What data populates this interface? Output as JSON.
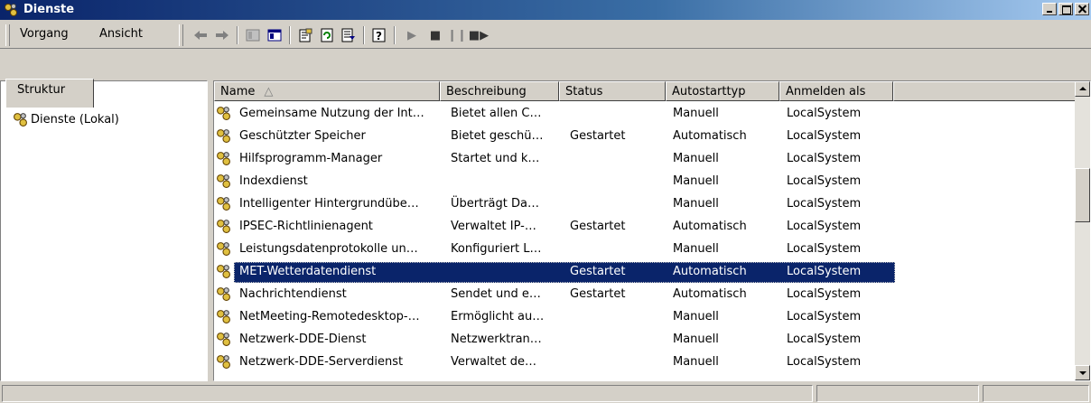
{
  "window": {
    "title": "Dienste"
  },
  "menu": {
    "vorgang": "Vorgang",
    "ansicht": "Ansicht"
  },
  "toolbar_icons": [
    "back-arrow-icon",
    "forward-arrow-icon",
    "console-tree-icon",
    "show-hide-pane-icon",
    "properties-icon",
    "refresh-icon",
    "export-list-icon",
    "help-icon",
    "play-icon",
    "stop-icon",
    "pause-icon",
    "restart-icon"
  ],
  "left": {
    "tab": "Struktur",
    "tree_item": "Dienste (Lokal)"
  },
  "table": {
    "columns": [
      "Name",
      "Beschreibung",
      "Status",
      "Autostarttyp",
      "Anmelden als"
    ],
    "rows": [
      [
        "Gemeinsame Nutzung der Int…",
        "Bietet allen C…",
        "",
        "Manuell",
        "LocalSystem"
      ],
      [
        "Geschützter Speicher",
        "Bietet geschü…",
        "Gestartet",
        "Automatisch",
        "LocalSystem"
      ],
      [
        "Hilfsprogramm-Manager",
        "Startet und k…",
        "",
        "Manuell",
        "LocalSystem"
      ],
      [
        "Indexdienst",
        "",
        "",
        "Manuell",
        "LocalSystem"
      ],
      [
        "Intelligenter Hintergrundübe…",
        "Überträgt Da…",
        "",
        "Manuell",
        "LocalSystem"
      ],
      [
        "IPSEC-Richtlinienagent",
        "Verwaltet IP-…",
        "Gestartet",
        "Automatisch",
        "LocalSystem"
      ],
      [
        "Leistungsdatenprotokolle un…",
        "Konfiguriert L…",
        "",
        "Manuell",
        "LocalSystem"
      ],
      [
        "MET-Wetterdatendienst",
        "",
        "Gestartet",
        "Automatisch",
        "LocalSystem"
      ],
      [
        "Nachrichtendienst",
        "Sendet und e…",
        "Gestartet",
        "Automatisch",
        "LocalSystem"
      ],
      [
        "NetMeeting-Remotedesktop-…",
        "Ermöglicht au…",
        "",
        "Manuell",
        "LocalSystem"
      ],
      [
        "Netzwerk-DDE-Dienst",
        "Netzwerktran…",
        "",
        "Manuell",
        "LocalSystem"
      ],
      [
        "Netzwerk-DDE-Serverdienst",
        "Verwaltet de…",
        "",
        "Manuell",
        "LocalSystem"
      ]
    ],
    "selected_index": 7
  },
  "colors": {
    "selection": "#0a246a",
    "title_start": "#0a246a",
    "face": "#d4d0c8"
  }
}
